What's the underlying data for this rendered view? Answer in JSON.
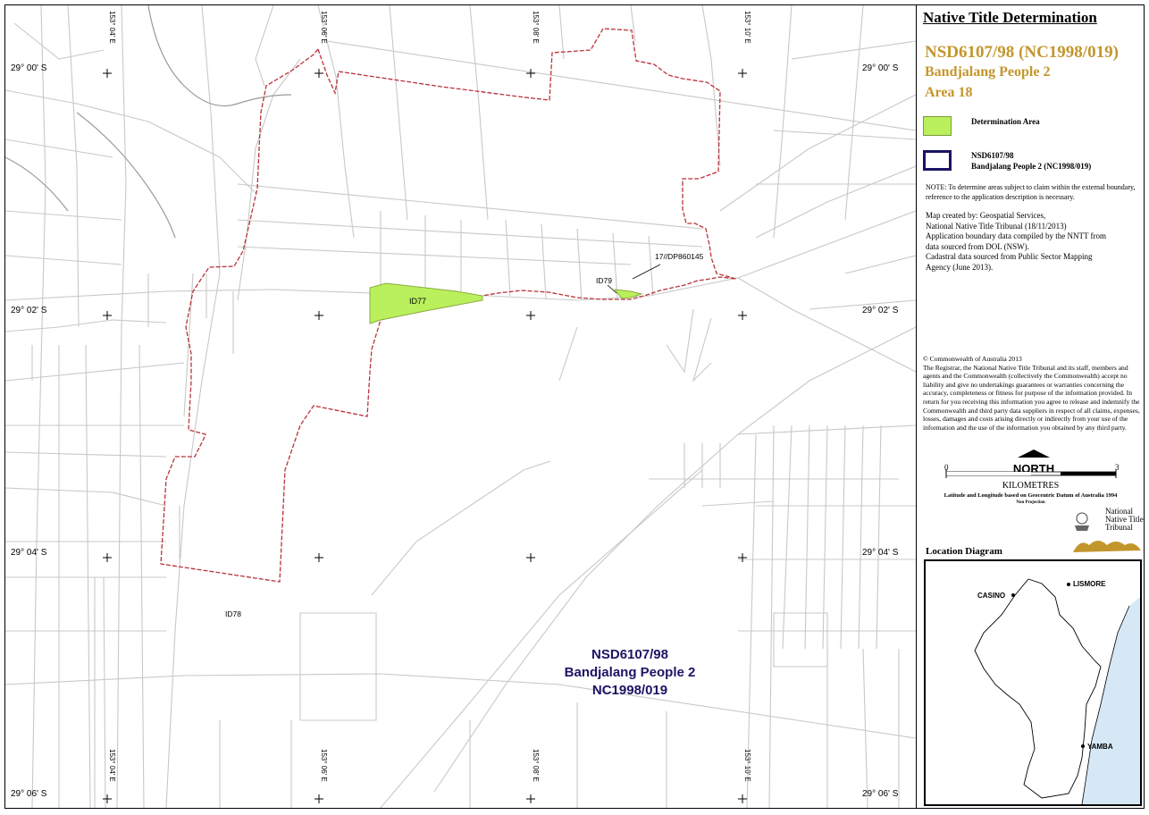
{
  "map": {
    "lon_labels_top": [
      "153° 04' E",
      "153° 06' E",
      "153° 08' E",
      "153° 10' E"
    ],
    "lon_labels_bottom": [
      "153° 04' E",
      "153° 06' E",
      "153° 08' E",
      "153° 10' E"
    ],
    "lat_labels_left": [
      "29° 00' S",
      "29° 02' S",
      "29° 04' S",
      "29° 06' S"
    ],
    "lat_labels_right": [
      "29° 00' S",
      "29° 02' S",
      "29° 04' S",
      "29° 06' S"
    ],
    "parcel_labels": {
      "id77": "ID77",
      "id79": "ID79",
      "id78": "ID78",
      "lot": "17//DP860145"
    },
    "claim_label": {
      "line1": "NSD6107/98",
      "line2": "Bandjalang People 2",
      "line3": "NC1998/019"
    },
    "colors": {
      "determination_fill": "#b9f05c",
      "boundary": "#b8333a",
      "cadastral": "#c8c8c8",
      "claim_label_color": "#1b1464"
    }
  },
  "panel": {
    "title": "Native Title Determination",
    "case_number": "NSD6107/98 (NC1998/019)",
    "people": "Bandjalang People 2",
    "area": "Area 18",
    "legend": {
      "determination_area": "Determination Area",
      "claim_line1": "NSD6107/98",
      "claim_line2": "Bandjalang People 2 (NC1998/019)"
    },
    "note": "NOTE: To determine areas subject to claim within the external boundary, reference to the application description is necessary.",
    "credits": [
      "Map created by: Geospatial Services,",
      "National Native Title Tribunal   (18/11/2013)",
      "Application boundary data compiled by the NNTT from",
      "data sourced from DOL (NSW).",
      "Cadastral data sourced from Public Sector Mapping",
      "Agency (June 2013)."
    ],
    "copyright_title": "© Commonwealth of Australia 2013",
    "copyright_text": "The Registrar, the National Native Title Tribunal and its staff, members and agents and the Commonwealth (collectively the Commonwealth) accept no liability and give no undertakings guarantees or warranties concerning the accuracy, completeness or fitness for purpose of the information provided. In return for you receiving this information you agree to release and indemnify the Commonwealth and third party data suppliers in respect of all claims, expenses, losses, damages and costs arising directly or indirectly from your use of the information and the use of the information you obtained by any third party.",
    "north_label": "NORTH",
    "scale_min": "0",
    "scale_max": "3",
    "scale_unit": "KILOMETRES",
    "datum": "Latitude and Longitude based on Geocentric Datum of Australia 1994",
    "projection": "Non Projection",
    "logo_line1": "National",
    "logo_line2": "Native Title",
    "logo_line3": "Tribunal",
    "location_title": "Location Diagram",
    "towns": {
      "casino": "CASINO",
      "lismore": "LISMORE",
      "yamba": "YAMBA"
    }
  }
}
